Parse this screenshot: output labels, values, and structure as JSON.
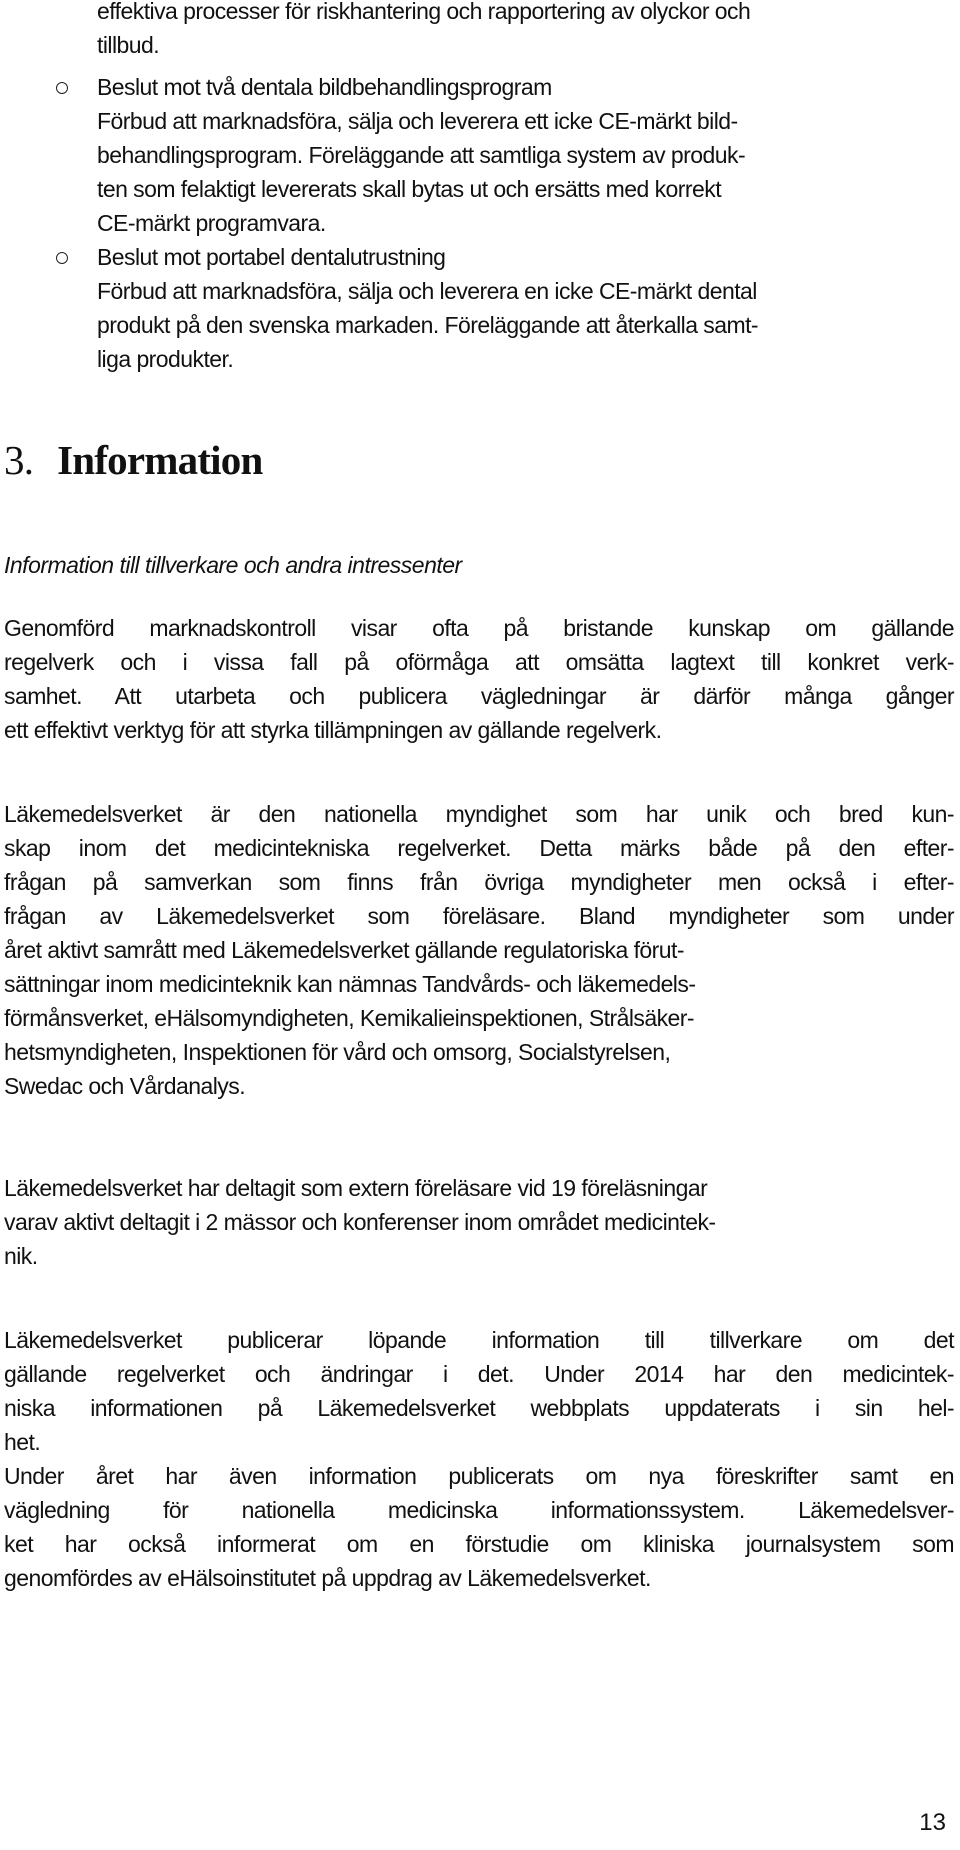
{
  "document": {
    "top_list_continuation": [
      "effektiva processer för riskhantering och rapportering av olyckor och",
      "tillbud."
    ],
    "bullet_items": [
      {
        "title": "Beslut mot två dentala bildbehandlingsprogram",
        "lines": [
          "Förbud att marknadsföra, sälja och leverera ett icke CE-märkt bild-",
          "behandlingsprogram. Föreläggande att samtliga system av produk-",
          "ten som felaktigt levererats skall bytas ut och ersätts med korrekt",
          "CE-märkt programvara."
        ]
      },
      {
        "title": "Beslut mot portabel dentalutrustning",
        "lines": [
          "Förbud att marknadsföra, sälja och leverera en icke CE-märkt dental",
          "produkt på den svenska markaden. Föreläggande att återkalla samt-",
          "liga produkter."
        ]
      }
    ],
    "section": {
      "number": "3.",
      "title": "Information",
      "subtitle": "Information till tillverkare och andra intressenter"
    },
    "paragraphs": [
      [
        "Genomförd marknadskontroll visar ofta på bristande kunskap om gällande",
        "regelverk och i vissa fall på oförmåga att omsätta lagtext till konkret verk-",
        "samhet. Att utarbeta och publicera vägledningar är därför många gånger",
        "ett effektivt verktyg för att styrka tillämpningen av gällande regelverk."
      ],
      [
        "Läkemedelsverket är den nationella myndighet som har unik och bred kun-",
        "skap inom det medicintekniska regelverket. Detta märks både på den efter-",
        "frågan på samverkan som finns från övriga myndigheter men också i efter-",
        "frågan av Läkemedelsverket som föreläsare. Bland myndigheter som under",
        "året aktivt samrått med Läkemedelsverket gällande regulatoriska förut-",
        "sättningar inom medicinteknik kan nämnas Tandvårds- och läkemedels-",
        "förmånsverket, eHälsomyndigheten, Kemikalieinspektionen, Strålsäker-",
        "hetsmyndigheten, Inspektionen för vård och omsorg, Socialstyrelsen,",
        "Swedac och Vårdanalys."
      ],
      [
        "Läkemedelsverket har deltagit som extern föreläsare vid 19 föreläsningar",
        "varav aktivt deltagit i 2 mässor och konferenser inom området medicintek-",
        "nik."
      ],
      [
        "Läkemedelsverket publicerar löpande information till tillverkare om det",
        "gällande regelverket och ändringar i det. Under 2014 har den medicintek-",
        "niska informationen på Läkemedelsverket webbplats uppdaterats i sin hel-",
        "het.",
        "Under året har även information publicerats om nya föreskrifter samt en",
        "vägledning för nationella medicinska informationssystem. Läkemedelsver-",
        "ket har också informerat om en förstudie om kliniska journalsystem som",
        "genomfördes av eHälsoinstitutet på uppdrag av Läkemedelsverket."
      ]
    ],
    "page_number": "13"
  }
}
